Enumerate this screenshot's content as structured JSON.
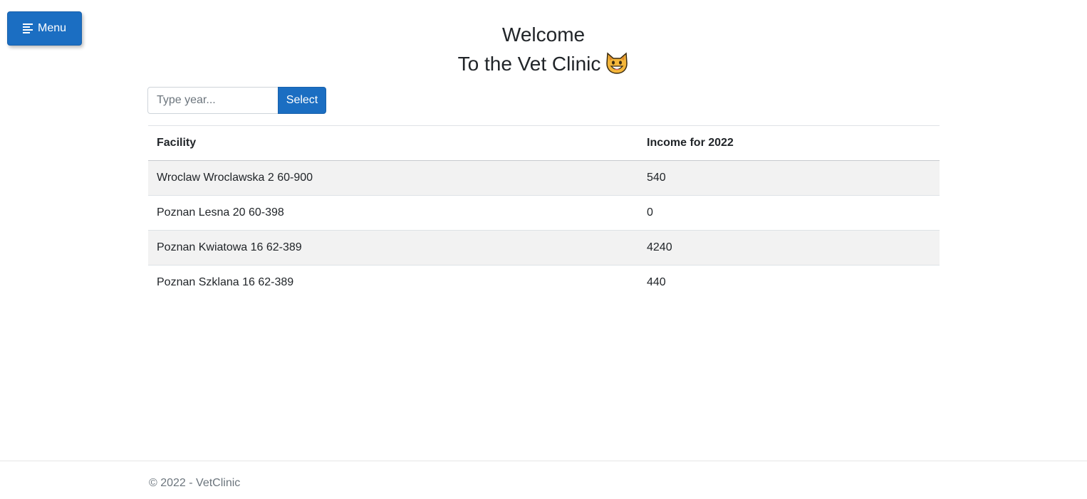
{
  "menu": {
    "label": "Menu",
    "icon": "menu-lines-icon"
  },
  "header": {
    "line1": "Welcome",
    "line2": "To the Vet Clinic",
    "emoji_icon": "grinning-cat-icon"
  },
  "search": {
    "placeholder": "Type year...",
    "value": "",
    "button_label": "Select"
  },
  "table": {
    "columns": [
      "Facility",
      "Income for 2022"
    ],
    "rows": [
      {
        "facility": "Wroclaw Wroclawska 2 60-900",
        "income": "540"
      },
      {
        "facility": "Poznan Lesna 20 60-398",
        "income": "0"
      },
      {
        "facility": "Poznan Kwiatowa 16 62-389",
        "income": "4240"
      },
      {
        "facility": "Poznan Szklana 16 62-389",
        "income": "440"
      }
    ]
  },
  "footer": {
    "text": "© 2022 - VetClinic"
  },
  "colors": {
    "primary": "#1b6ec2",
    "stripe": "#f2f2f2",
    "muted": "#6c757d"
  }
}
